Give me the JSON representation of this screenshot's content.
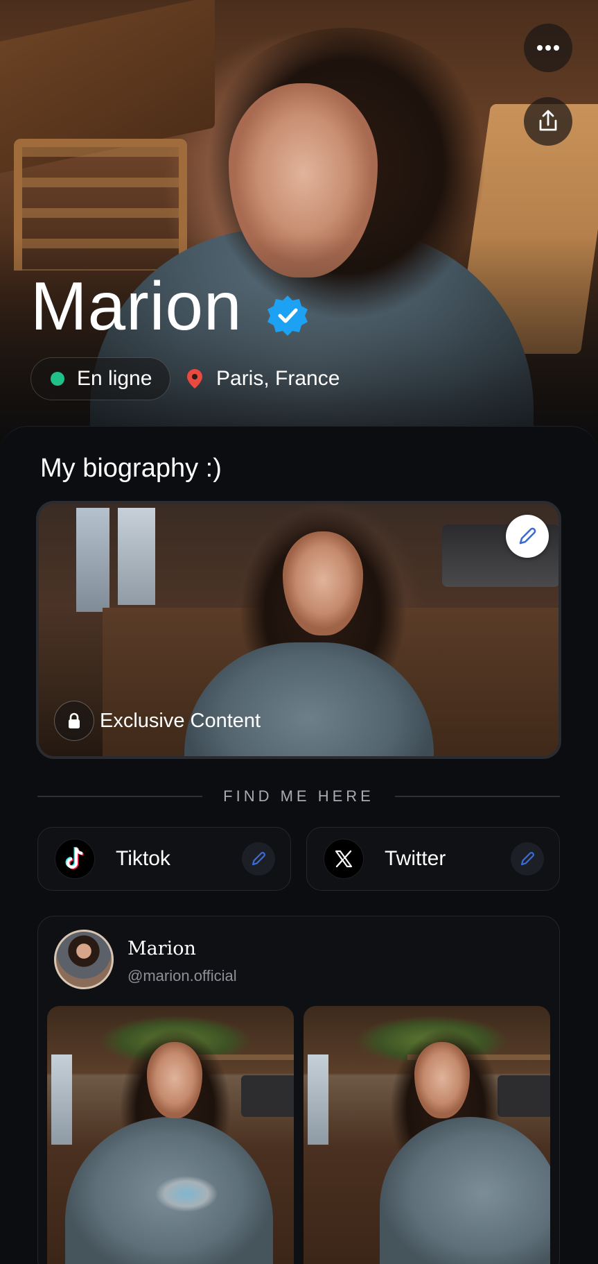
{
  "profile": {
    "name": "Marion",
    "status": "En ligne",
    "location": "Paris, France"
  },
  "biography": {
    "title": "My biography :)",
    "badge_label": "Exclusive Content"
  },
  "links_section": {
    "heading": "FIND ME HERE",
    "items": [
      {
        "label": "Tiktok",
        "icon": "tiktok-icon"
      },
      {
        "label": "Twitter",
        "icon": "x-icon"
      }
    ]
  },
  "post": {
    "name": "Marion",
    "handle": "@marion.official"
  },
  "icons": {
    "more": "more-dots-icon",
    "share": "share-icon",
    "verified": "verified-badge-icon",
    "location": "location-pin-icon",
    "edit": "pencil-icon",
    "lock": "lock-icon"
  },
  "colors": {
    "background": "#0b0c0e",
    "online": "#21c08a",
    "verified": "#1da1f2",
    "pin": "#e84a3f",
    "edit_accent": "#3b6bd9"
  }
}
